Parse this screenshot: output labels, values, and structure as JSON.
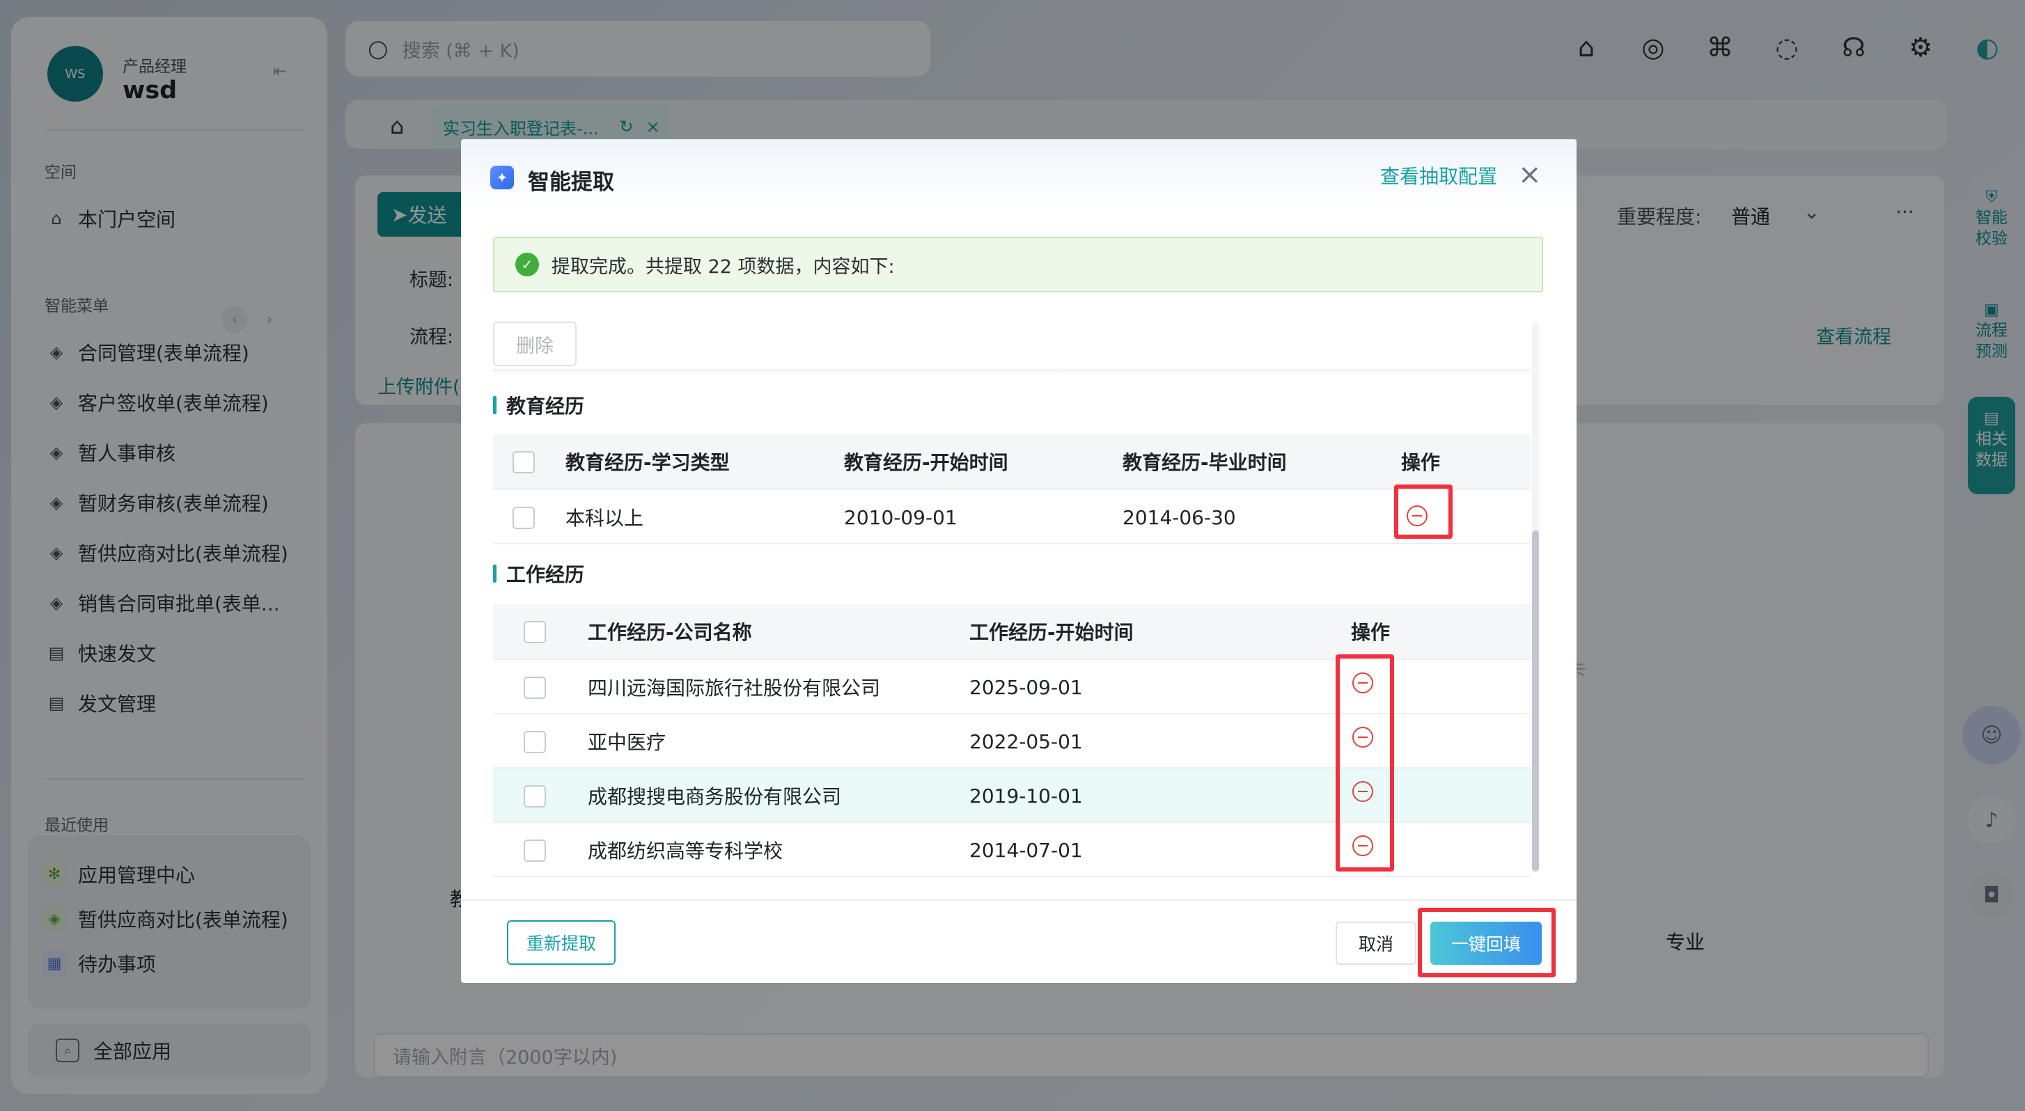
{
  "sidebar": {
    "avatar_text": "WS",
    "role": "产品经理",
    "user": "wsd",
    "space_title": "空间",
    "space_item": "本门户空间",
    "menu_title": "智能菜单",
    "menu_items": [
      {
        "label": "合同管理(表单流程)"
      },
      {
        "label": "客户签收单(表单流程)"
      },
      {
        "label": "暂人事审核"
      },
      {
        "label": "暂财务审核(表单流程)"
      },
      {
        "label": "暂供应商对比(表单流程)"
      },
      {
        "label": "销售合同审批单(表单..."
      },
      {
        "label": "快速发文"
      },
      {
        "label": "发文管理"
      }
    ],
    "recent_title": "最近使用",
    "recent_items": [
      {
        "label": "应用管理中心"
      },
      {
        "label": "暂供应商对比(表单流程)"
      },
      {
        "label": "待办事项"
      }
    ],
    "all_apps": "全部应用"
  },
  "topbar": {
    "search_placeholder": "搜索 (⌘ + K)"
  },
  "tabs": {
    "active_label": "实习生入职登记表-...",
    "refresh": "↻",
    "close": "×"
  },
  "background": {
    "send_label": "发送",
    "title_label": "标题:",
    "flow_label": "流程:",
    "upload_label": "上传附件(",
    "importance_label": "重要程度:",
    "importance_value": "普通",
    "view_flow": "查看流程",
    "more": "···",
    "card_fragment": "卡",
    "major_header": "专业",
    "row_fragment": "教",
    "comment_placeholder": "请输入附言（2000字以内)"
  },
  "rail": {
    "verify": "智能校验",
    "predict": "流程预测",
    "related": "相关数据"
  },
  "dialog": {
    "title": "智能提取",
    "config_link": "查看抽取配置",
    "success_text": "提取完成。共提取 22 项数据，内容如下:",
    "delete_label": "删除",
    "education": {
      "section_title": "教育经历",
      "columns": [
        "教育经历-学习类型",
        "教育经历-开始时间",
        "教育经历-毕业时间",
        "操作"
      ],
      "rows": [
        {
          "type": "本科以上",
          "start": "2010-09-01",
          "end": "2014-06-30"
        }
      ]
    },
    "work": {
      "section_title": "工作经历",
      "columns": [
        "工作经历-公司名称",
        "工作经历-开始时间",
        "操作"
      ],
      "rows": [
        {
          "company": "四川远海国际旅行社股份有限公司",
          "start": "2025-09-01"
        },
        {
          "company": "亚中医疗",
          "start": "2022-05-01"
        },
        {
          "company": "成都搜搜电商务股份有限公司",
          "start": "2019-10-01"
        },
        {
          "company": "成都纺织高等专科学校",
          "start": "2014-07-01"
        }
      ]
    },
    "refetch_label": "重新提取",
    "cancel_label": "取消",
    "fill_label": "一键回填"
  },
  "colors": {
    "accent": "#17a2a5",
    "highlight_box": "#f0313d",
    "success_bg": "#eef8e8"
  }
}
